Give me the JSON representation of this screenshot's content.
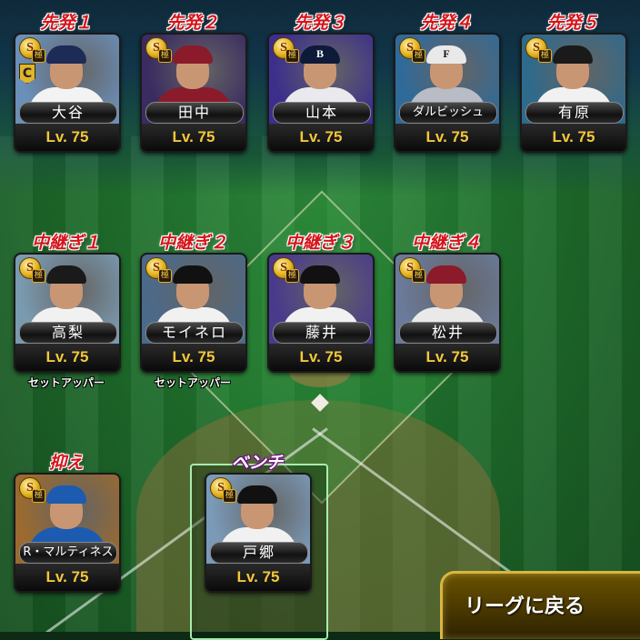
{
  "screen": {
    "accent_red": "#d6141b",
    "level_color": "#f3c83a"
  },
  "starters": [
    {
      "slot": "先発１",
      "name": "大谷",
      "level": "Lv. 75",
      "rank": "S",
      "grade": "極",
      "has_c_badge": true,
      "cap_letter": "",
      "team_color": "#f3f3f3",
      "cap_color": "#1d2b57",
      "bg": "#6a8fb8"
    },
    {
      "slot": "先発２",
      "name": "田中",
      "level": "Lv. 75",
      "rank": "S",
      "grade": "極",
      "has_c_badge": false,
      "cap_letter": "",
      "team_color": "#8b1b2a",
      "cap_color": "#8b1b2a",
      "bg": "#3a2b60"
    },
    {
      "slot": "先発３",
      "name": "山本",
      "level": "Lv. 75",
      "rank": "S",
      "grade": "極",
      "has_c_badge": false,
      "cap_letter": "B",
      "team_color": "#e9e9ee",
      "cap_color": "#0d1a3a",
      "bg": "#3c2f8c"
    },
    {
      "slot": "先発４",
      "name": "ダルビッシュ",
      "level": "Lv. 75",
      "rank": "S",
      "grade": "極",
      "has_c_badge": false,
      "cap_letter": "F",
      "team_color": "#b8bcc4",
      "cap_color": "#e9e9e9",
      "bg": "#2f6a9a"
    },
    {
      "slot": "先発５",
      "name": "有原",
      "level": "Lv. 75",
      "rank": "S",
      "grade": "極",
      "has_c_badge": false,
      "cap_letter": "",
      "team_color": "#f1f1f1",
      "cap_color": "#1a1a1a",
      "bg": "#2e6a8c"
    }
  ],
  "relievers": [
    {
      "slot": "中継ぎ１",
      "name": "高梨",
      "level": "Lv. 75",
      "rank": "S",
      "grade": "極",
      "role": "セットアッパー",
      "cap_letter": "",
      "team_color": "#f1f1f1",
      "cap_color": "#1a1a1a",
      "bg": "#7a9ab0"
    },
    {
      "slot": "中継ぎ２",
      "name": "モイネロ",
      "level": "Lv. 75",
      "rank": "S",
      "grade": "極",
      "role": "セットアッパー",
      "cap_letter": "",
      "team_color": "#f1f1f1",
      "cap_color": "#111111",
      "bg": "#4b6a8a"
    },
    {
      "slot": "中継ぎ３",
      "name": "藤井",
      "level": "Lv. 75",
      "rank": "S",
      "grade": "極",
      "role": "",
      "cap_letter": "",
      "team_color": "#f1f1f1",
      "cap_color": "#111111",
      "bg": "#4a3a8c"
    },
    {
      "slot": "中継ぎ４",
      "name": "松井",
      "level": "Lv. 75",
      "rank": "S",
      "grade": "極",
      "role": "",
      "cap_letter": "",
      "team_color": "#e9e9e9",
      "cap_color": "#8b1b2a",
      "bg": "#6a7a9a"
    }
  ],
  "closer": {
    "slot": "抑え",
    "name": "R・マルティネス",
    "level": "Lv. 75",
    "rank": "S",
    "grade": "極",
    "cap_letter": "",
    "team_color": "#1c5bb0",
    "cap_color": "#1c5bb0",
    "bg": "#9a6a30"
  },
  "bench": {
    "slot": "ベンチ",
    "name": "戸郷",
    "level": "Lv. 75",
    "rank": "S",
    "grade": "極",
    "cap_letter": "",
    "team_color": "#f1f1f1",
    "cap_color": "#111111",
    "bg": "#7a9ab8"
  },
  "return_button": {
    "label": "リーグに戻る"
  }
}
